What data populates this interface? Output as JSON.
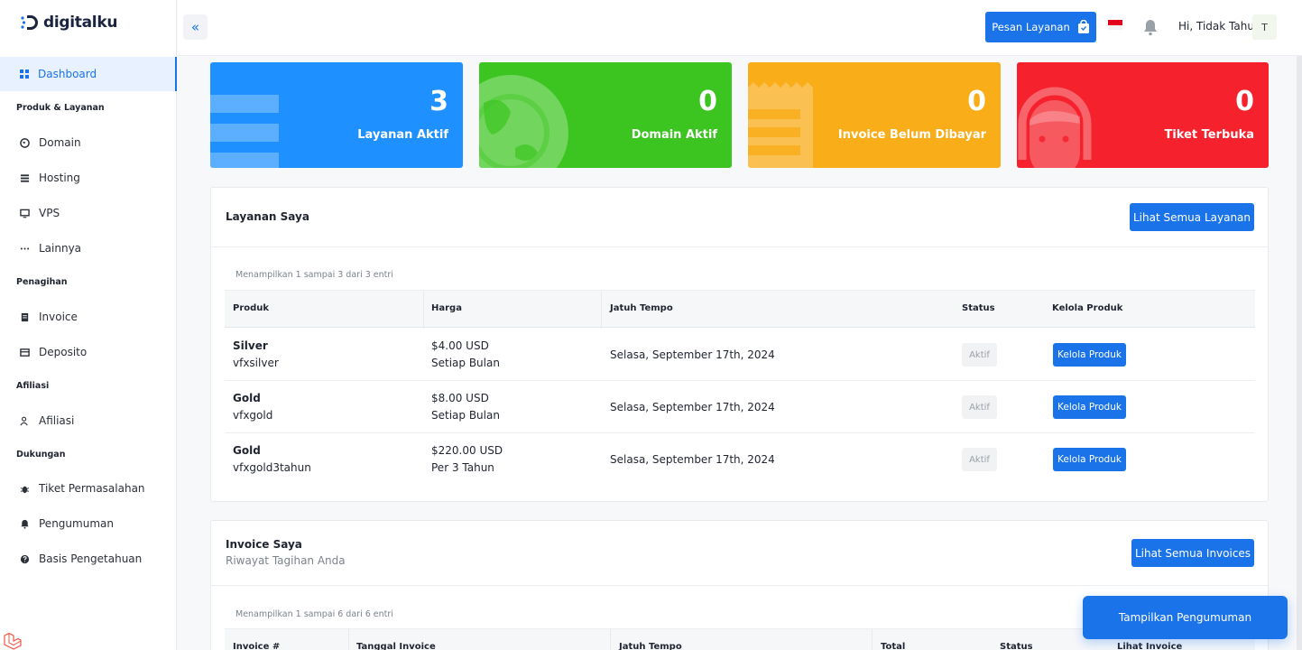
{
  "brand": {
    "name": "digitalku"
  },
  "sidebar": {
    "active": {
      "label": "Dashboard"
    },
    "sections": {
      "produk": "Produk & Layanan",
      "penagihan": "Penagihan",
      "afiliasi": "Afiliasi",
      "dukungan": "Dukungan"
    },
    "items": {
      "domain": "Domain",
      "hosting": "Hosting",
      "vps": "VPS",
      "lainnya": "Lainnya",
      "invoice": "Invoice",
      "deposito": "Deposito",
      "afiliasi": "Afiliasi",
      "tiket": "Tiket Permasalahan",
      "pengumuman": "Pengumuman",
      "basis": "Basis Pengetahuan"
    }
  },
  "header": {
    "order_label": "Pesan Layanan",
    "greeting": "Hi,  Tidak Tahu",
    "avatar_initial": "T"
  },
  "stats": [
    {
      "value": "3",
      "label": "Layanan Aktif",
      "color": "#1e90ff"
    },
    {
      "value": "0",
      "label": "Domain Aktif",
      "color": "#3cc520"
    },
    {
      "value": "0",
      "label": "Invoice Belum Dibayar",
      "color": "#f9ad18"
    },
    {
      "value": "0",
      "label": "Tiket Terbuka",
      "color": "#f5222d"
    }
  ],
  "services": {
    "title": "Layanan Saya",
    "view_all": "Lihat Semua Layanan",
    "entries_text": "Menampilkan 1 sampai 3 dari 3 entri",
    "columns": [
      "Produk",
      "Harga",
      "Jatuh Tempo",
      "Status",
      "Kelola Produk"
    ],
    "rows": [
      {
        "name": "Silver",
        "code": "vfxsilver",
        "price": "$4.00 USD",
        "cycle": "Setiap Bulan",
        "due": "Selasa, September 17th, 2024",
        "status": "Aktif",
        "action": "Kelola Produk"
      },
      {
        "name": "Gold",
        "code": "vfxgold",
        "price": "$8.00 USD",
        "cycle": "Setiap Bulan",
        "due": "Selasa, September 17th, 2024",
        "status": "Aktif",
        "action": "Kelola Produk"
      },
      {
        "name": "Gold",
        "code": "vfxgold3tahun",
        "price": "$220.00 USD",
        "cycle": "Per 3 Tahun",
        "due": "Selasa, September 17th, 2024",
        "status": "Aktif",
        "action": "Kelola Produk"
      }
    ]
  },
  "invoices": {
    "title": "Invoice Saya",
    "subtitle": "Riwayat Tagihan Anda",
    "view_all": "Lihat Semua Invoices",
    "entries_text": "Menampilkan 1 sampai 6 dari 6 entri",
    "columns": [
      "Invoice #",
      "Tanggal Invoice",
      "Jatuh Tempo",
      "Total",
      "Status",
      "Lihat Invoice"
    ]
  },
  "floating": {
    "label": "Tampilkan Pengumuman"
  }
}
